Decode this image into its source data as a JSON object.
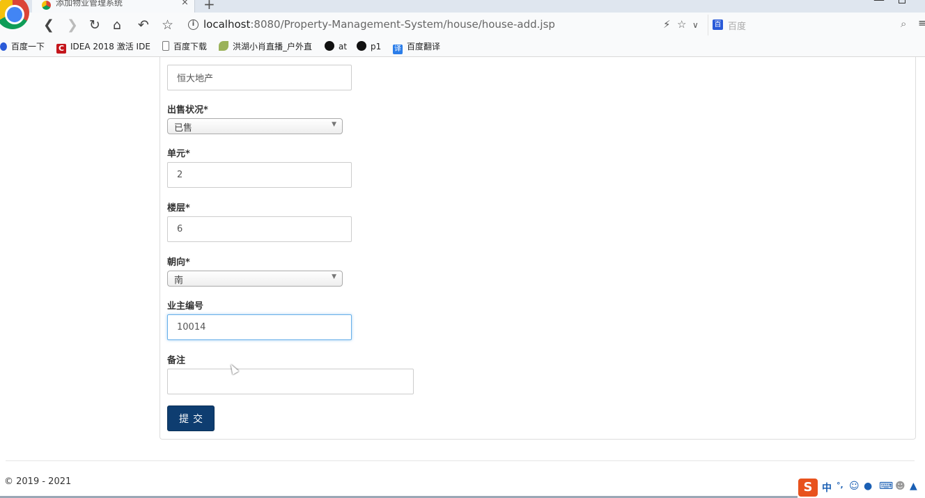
{
  "browser": {
    "tab_title": "添加物业管理系统",
    "tab_close": "×",
    "new_tab": "+",
    "url_host": "localhost",
    "url_rest": ":8080/Property-Management-System/house/house-add.jsp",
    "search_placeholder": "百度",
    "bookmarks": [
      {
        "label": "百度一下",
        "icon": "baidu-paw-icon",
        "color": "#2a5ad8"
      },
      {
        "label": "IDEA 2018 激活 IDE",
        "icon": "idea-c-icon",
        "color": "#c4161c"
      },
      {
        "label": "百度下载",
        "icon": "document-icon",
        "color": "#888888"
      },
      {
        "label": "洪湖小肖直播_户外直",
        "icon": "wing-icon",
        "color": "#6b8e23"
      },
      {
        "label": "at",
        "icon": "github-icon",
        "color": "#111111"
      },
      {
        "label": "p1",
        "icon": "github-icon",
        "color": "#111111"
      },
      {
        "label": "百度翻译",
        "icon": "translate-icon",
        "color": "#2b7de9"
      }
    ]
  },
  "form": {
    "developer_value": "恒大地产",
    "sale_status_label": "出售状况*",
    "sale_status_value": "已售",
    "unit_label": "单元*",
    "unit_value": "2",
    "floor_label": "楼层*",
    "floor_value": "6",
    "orientation_label": "朝向*",
    "orientation_value": "南",
    "owner_id_label": "业主编号",
    "owner_id_value": "10014",
    "remark_label": "备注",
    "remark_value": "",
    "submit_label": "提交"
  },
  "footer": {
    "copyright": "© 2019 - 2021"
  },
  "ime": {
    "logo": "S",
    "mode": "中",
    "punct": "°,"
  },
  "colors": {
    "submit_bg": "#0e3d70",
    "focus_border": "#66afe9",
    "ime_orange": "#e8521d"
  }
}
